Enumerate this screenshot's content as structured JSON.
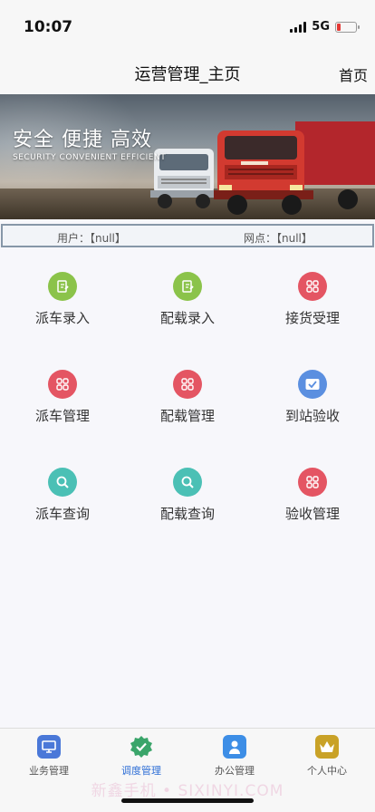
{
  "status": {
    "time": "10:07",
    "network": "5G"
  },
  "nav": {
    "title": "运营管理_主页",
    "home": "首页"
  },
  "banner": {
    "title": "安全 便捷 高效",
    "subtitle": "SECURITY CONVENIENT EFFICIENT"
  },
  "info": {
    "user_label": "用户：",
    "user_value": "【null】",
    "site_label": "网点：",
    "site_value": "【null】"
  },
  "menu": [
    {
      "label": "派车录入",
      "icon": "edit-icon",
      "color": "#8bc34a"
    },
    {
      "label": "配载录入",
      "icon": "edit-icon",
      "color": "#8bc34a"
    },
    {
      "label": "接货受理",
      "icon": "grid-icon",
      "color": "#e45563"
    },
    {
      "label": "派车管理",
      "icon": "grid-icon",
      "color": "#e45563"
    },
    {
      "label": "配载管理",
      "icon": "grid-icon",
      "color": "#e45563"
    },
    {
      "label": "到站验收",
      "icon": "check-icon",
      "color": "#5b8fe0"
    },
    {
      "label": "派车查询",
      "icon": "search-icon",
      "color": "#4bc0b5"
    },
    {
      "label": "配载查询",
      "icon": "search-icon",
      "color": "#4bc0b5"
    },
    {
      "label": "验收管理",
      "icon": "grid-icon",
      "color": "#e45563"
    }
  ],
  "tabs": [
    {
      "label": "业务管理",
      "icon": "monitor-icon"
    },
    {
      "label": "调度管理",
      "icon": "badge-check-icon",
      "active": true
    },
    {
      "label": "办公管理",
      "icon": "person-icon"
    },
    {
      "label": "个人中心",
      "icon": "crown-icon"
    }
  ],
  "watermark": "新鑫手机 • SIXINYI.COM"
}
